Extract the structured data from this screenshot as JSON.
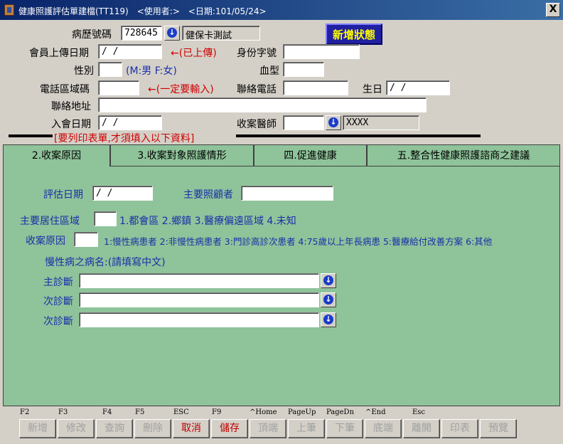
{
  "window": {
    "title": "健康照護評估單建檔(TT119)　<使用者:>　<日期:101/05/24>",
    "close_label": "X"
  },
  "header": {
    "record_no_label": "病歷號碼",
    "record_no_value": "728645",
    "card_test_value": "健保卡測試",
    "new_state_label": "新增狀態",
    "upload_date_label": "會員上傳日期",
    "upload_date_value": " / /",
    "uploaded_note": "←(已上傳)",
    "id_label": "身份字號",
    "id_value": "",
    "gender_label": "性別",
    "gender_value": "",
    "gender_hint": "(M:男 F:女)",
    "blood_label": "血型",
    "blood_value": "",
    "area_code_label": "電話區域碼",
    "area_code_value": "",
    "area_code_note": "←(一定要輸入)",
    "phone_label": "聯絡電話",
    "phone_value": "",
    "birthday_label": "生日",
    "birthday_value": " / /",
    "address_label": "聯絡地址",
    "address_value": "",
    "join_date_label": "入會日期",
    "join_date_value": " / /",
    "doctor_label": "收案醫師",
    "doctor_value": "",
    "doctor_name": "XXXX",
    "print_notice": "[要列印表單,才須填入以下資料]"
  },
  "tabs": [
    {
      "label": "2.收案原因"
    },
    {
      "label": "3.收案對象照護情形"
    },
    {
      "label": "四.促進健康"
    },
    {
      "label": "五.整合性健康照護諮商之建議"
    }
  ],
  "pane": {
    "eval_date_label": "評估日期",
    "eval_date_value": " / /",
    "caregiver_label": "主要照顧者",
    "caregiver_value": "",
    "residence_label": "主要居住區域",
    "residence_value": "",
    "residence_options": "1.都會區 2.鄉鎮 3.醫療偏遠區域 4.未知",
    "reason_label": "收案原因",
    "reason_value": "",
    "reason_options": "1:慢性病患者 2:非慢性病患者 3:門診高診次患者 4:75歲以上年長病患 5:醫療給付改善方案 6:其他",
    "chronic_label": "慢性病之病名:(請填寫中文)",
    "main_diag_label": "主診斷",
    "main_diag_value": "",
    "sub_diag1_label": "次診斷",
    "sub_diag1_value": "",
    "sub_diag2_label": "次診斷",
    "sub_diag2_value": ""
  },
  "toolbar": {
    "keys": [
      "F2",
      "F3",
      "F4",
      "F5",
      "ESC",
      "F9",
      "^Home",
      "PageUp",
      "PageDn",
      "^End",
      "Esc"
    ],
    "buttons": [
      "新增",
      "修改",
      "查詢",
      "刪除",
      "取消",
      "儲存",
      "頂端",
      "上筆",
      "下筆",
      "底端",
      "離開",
      "印表",
      "預覽"
    ]
  },
  "colors": {
    "pane_bg": "#8fc39a",
    "label_blue": "#1a2fa8",
    "note_red": "#d00000",
    "title_bar": "#0a246a"
  }
}
